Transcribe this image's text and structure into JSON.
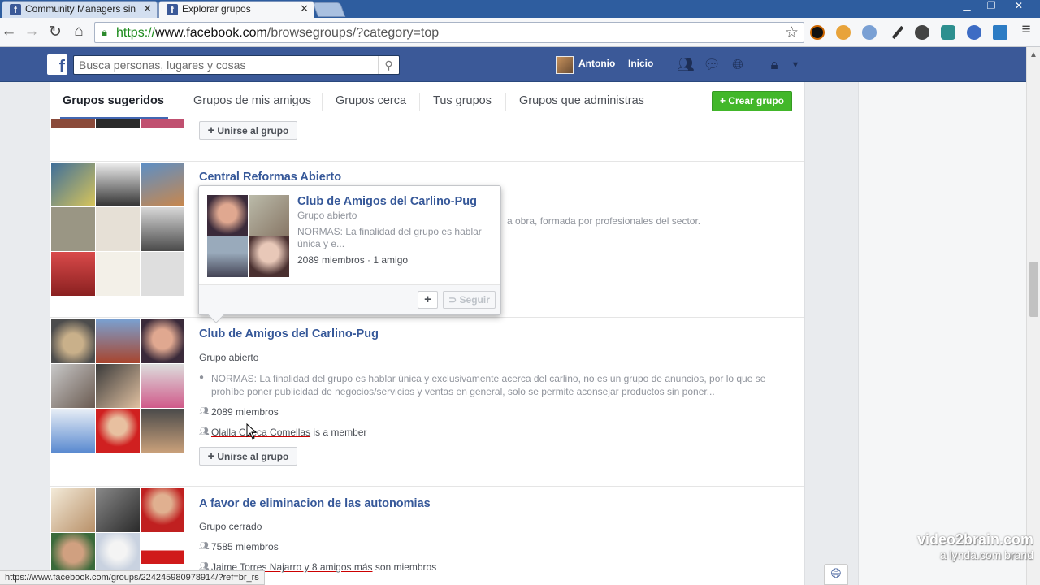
{
  "browser": {
    "tabs": [
      {
        "title": "Community Managers sin",
        "close": "✕"
      },
      {
        "title": "Explorar grupos",
        "close": "✕"
      }
    ],
    "url": {
      "scheme": "https://",
      "host": "www.facebook.com",
      "path": "/browsegroups/?category=top"
    },
    "status_url": "https://www.facebook.com/groups/224245980978914/?ref=br_rs"
  },
  "fb": {
    "logo": "f",
    "search_placeholder": "Busca personas, lugares y cosas",
    "user_name": "Antonio",
    "home_label": "Inicio"
  },
  "tabs": [
    {
      "label": "Grupos sugeridos",
      "active": true
    },
    {
      "label": "Grupos de mis amigos"
    },
    {
      "label": "Grupos cerca"
    },
    {
      "label": "Tus grupos"
    },
    {
      "label": "Grupos que administras"
    }
  ],
  "create_group_label": "+ Crear grupo",
  "join_label": "Unirse al grupo",
  "groups": [
    {
      "name": "Central Reformas Abierto",
      "desc_fragment": "a obra, formada por profesionales del sector."
    },
    {
      "name": "Club de Amigos del Carlino-Pug",
      "type": "Grupo abierto",
      "description": "NORMAS: La finalidad del grupo es hablar única y exclusivamente acerca del carlino, no es un grupo de anuncios, por lo que se prohíbe poner publicidad de negocios/servicios y ventas en general, solo se permite aconsejar productos sin poner...",
      "members": "2089 miembros",
      "friend_member": "Olalla Checa Comellas",
      "friend_suffix": "is a member"
    },
    {
      "name": "A favor de eliminacion de las autonomias",
      "type": "Grupo cerrado",
      "members": "7585 miembros",
      "friends_link": "Jaime Torres Najarro y 8 amigos más",
      "friends_suffix": "son miembros"
    }
  ],
  "hovercard": {
    "name": "Club de Amigos del Carlino-Pug",
    "type": "Grupo abierto",
    "desc": "NORMAS: La finalidad del grupo es hablar única y e...",
    "counts": "2089 miembros · 1 amigo",
    "add": "+",
    "follow": "Seguir"
  },
  "watermark": {
    "line1": "video2brain.com",
    "line2": "a lynda.com brand"
  }
}
